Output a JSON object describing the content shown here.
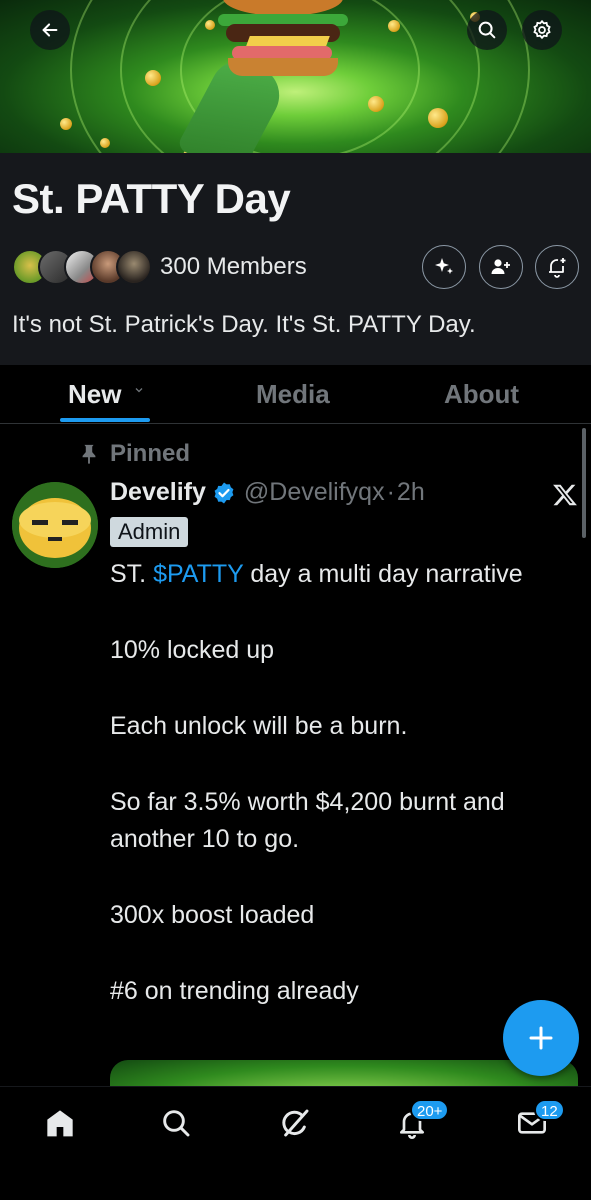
{
  "community": {
    "name": "St. PATTY Day",
    "members_label": "300 Members",
    "description": "It's not St. Patrick's Day. It's St. PATTY Day."
  },
  "tabs": [
    {
      "label": "New",
      "active": true
    },
    {
      "label": "Media",
      "active": false
    },
    {
      "label": "About",
      "active": false
    }
  ],
  "post": {
    "pinned_label": "Pinned",
    "author_name": "Develify",
    "handle": "@Develifyqx",
    "separator": "·",
    "time": "2h",
    "role_badge": "Admin",
    "verified": true,
    "text": {
      "line1_before": "ST. ",
      "cashtag": "$PATTY",
      "line1_after": " day a multi day narrative",
      "p2": "10% locked up",
      "p3": "Each unlock will be a burn.",
      "p4": "So far 3.5% worth $4,200 burnt and another 10 to go.",
      "p5": "300x boost loaded",
      "p6": "#6 on trending already"
    }
  },
  "nav": {
    "notifications_badge": "20+",
    "messages_badge": "12"
  },
  "icons": {
    "back": "arrow-left-icon",
    "search": "search-icon",
    "settings": "gear-icon",
    "grok": "sparkle-icon",
    "invite": "add-user-icon",
    "notify": "bell-plus-icon",
    "pin": "pin-icon",
    "verified": "verified-badge-icon",
    "x_logo": "x-logo-icon",
    "compose": "plus-icon",
    "home": "home-icon",
    "explore": "search-icon",
    "grok_nav": "grok-icon",
    "notifications": "bell-icon",
    "messages": "envelope-icon"
  },
  "colors": {
    "accent": "#1d9bf0",
    "background": "#000000",
    "header_bg": "#16181c",
    "muted_text": "#71767b"
  }
}
